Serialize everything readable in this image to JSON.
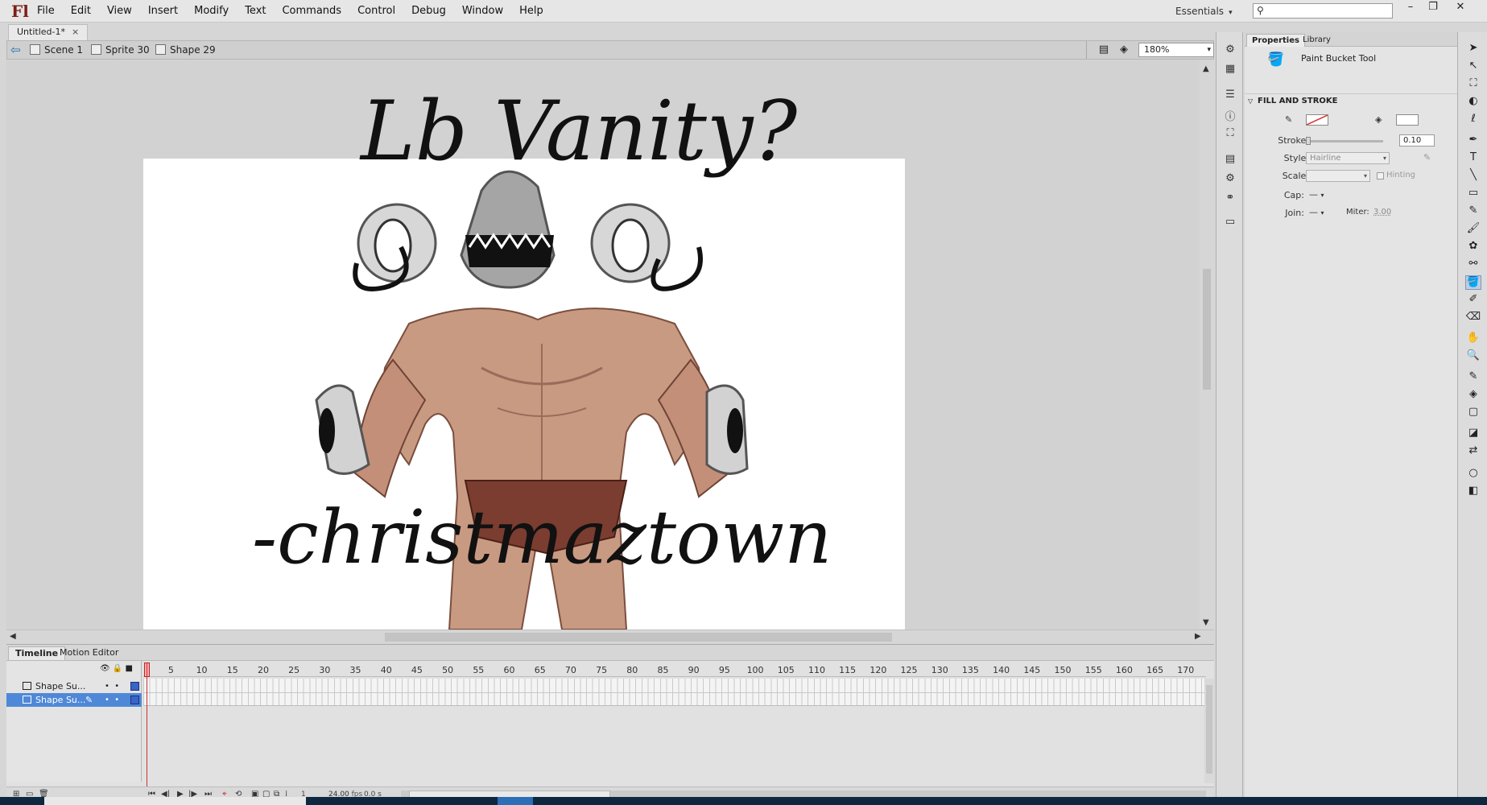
{
  "app": {
    "logo": "Fl",
    "workspace": "Essentials",
    "search_placeholder": ""
  },
  "menu": [
    "File",
    "Edit",
    "View",
    "Insert",
    "Modify",
    "Text",
    "Commands",
    "Control",
    "Debug",
    "Window",
    "Help"
  ],
  "document": {
    "tab_title": "Untitled-1*",
    "breadcrumbs": [
      "Scene 1",
      "Sprite 30",
      "Shape 29"
    ],
    "zoom": "180%"
  },
  "stage": {
    "title_text": "Lb Vanity?",
    "signature_text": "-christmaztown"
  },
  "timeline": {
    "tabs": [
      "Timeline",
      "Motion Editor"
    ],
    "layers": [
      {
        "name": "Shape Su...",
        "selected": false
      },
      {
        "name": "Shape Su...",
        "selected": true
      }
    ],
    "frame_ticks": [
      "5",
      "10",
      "15",
      "20",
      "25",
      "30",
      "35",
      "40",
      "45",
      "50",
      "55",
      "60",
      "65",
      "70",
      "75",
      "80",
      "85",
      "90",
      "95",
      "100",
      "105",
      "110",
      "115",
      "120",
      "125",
      "130",
      "135",
      "140",
      "145",
      "150",
      "155",
      "160",
      "165",
      "170"
    ],
    "current_frame": "1",
    "fps": "24.00",
    "fps_unit": "fps",
    "time": "0.0 s"
  },
  "properties": {
    "tabs": [
      "Properties",
      "Library"
    ],
    "tool_name": "Paint Bucket Tool",
    "section": "FILL AND STROKE",
    "stroke_label": "Stroke:",
    "stroke_value": "0.10",
    "style_label": "Style:",
    "style_value": "Hairline",
    "scale_label": "Scale:",
    "scale_value": "",
    "hinting_label": "Hinting",
    "cap_label": "Cap:",
    "cap_value": "—",
    "join_label": "Join:",
    "join_value": "—",
    "miter_label": "Miter:",
    "miter_value": "3.00"
  },
  "colors": {
    "selected_layer": "#4f88d7",
    "playhead": "#d23030",
    "logo": "#7a1f16"
  }
}
